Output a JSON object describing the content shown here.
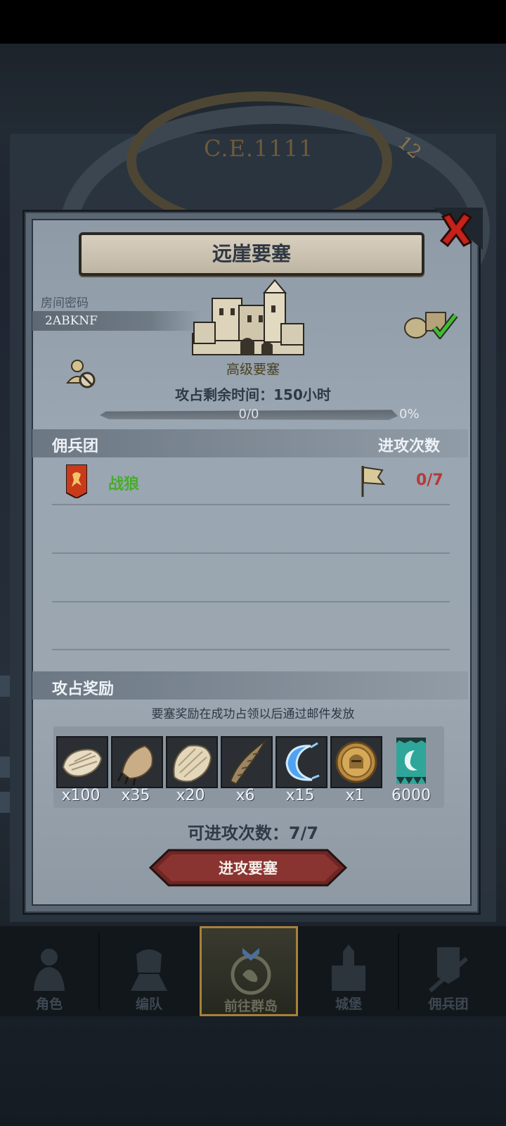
{
  "background": {
    "era_label": "C.E.1111",
    "era_number": "12"
  },
  "dialog": {
    "title": "远崖要塞",
    "room_code_label": "房间密码",
    "room_code": "2ABKNF",
    "fortress_level": "高级要塞",
    "occupy_time": "攻占剩余时间：150小时",
    "progress_text": "0/0",
    "progress_percent": "0%",
    "progress_fraction": 0,
    "mercenary_header": "佣兵团",
    "attack_count_header": "进攻次数",
    "guilds": [
      {
        "name": "战狼",
        "attacks": "0/7"
      }
    ],
    "rewards_header": "攻占奖励",
    "rewards_note": "要塞奖励在成功占领以后通过邮件发放",
    "rewards": [
      {
        "icon": "fur-pelt-icon",
        "qty": "x100"
      },
      {
        "icon": "beast-claw-icon",
        "qty": "x35"
      },
      {
        "icon": "hide-icon",
        "qty": "x20"
      },
      {
        "icon": "horn-icon",
        "qty": "x6"
      },
      {
        "icon": "crescent-crystal-icon",
        "qty": "x15"
      },
      {
        "icon": "knight-medal-icon",
        "qty": "x1"
      },
      {
        "icon": "guild-banner-icon",
        "qty": "6000"
      }
    ],
    "attack_times": "可进攻次数：7/7",
    "attack_button": "进攻要塞"
  },
  "nav": [
    {
      "label": "角色",
      "icon": "character-icon"
    },
    {
      "label": "编队",
      "icon": "formation-icon"
    },
    {
      "label": "前往群岛",
      "icon": "islands-icon",
      "active": true
    },
    {
      "label": "城堡",
      "icon": "castle-icon"
    },
    {
      "label": "佣兵团",
      "icon": "mercenary-icon"
    }
  ],
  "colors": {
    "guild_name": "#47ad2c",
    "attack_count": "#b53a3a",
    "close_red": "#c4221a",
    "button_red": "#7a2a28",
    "nav_active_border": "#a7813a"
  }
}
